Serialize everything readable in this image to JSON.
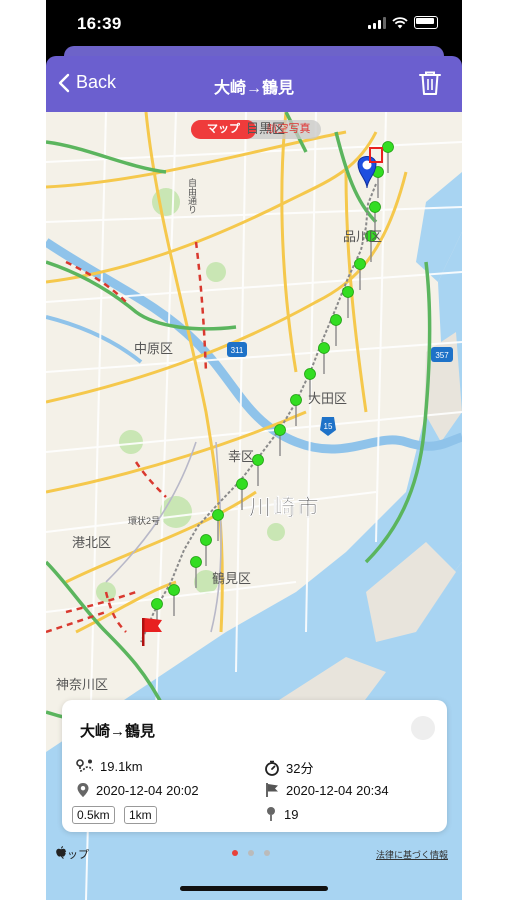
{
  "status_bar": {
    "time": "16:39"
  },
  "nav": {
    "back_label": "Back",
    "title": "大崎→鶴見"
  },
  "map": {
    "segment": {
      "options": [
        "マップ",
        "航空写真"
      ],
      "selected": 0
    },
    "labels": {
      "meguro": "目黒区",
      "shinagawa": "品川区",
      "nakahara": "中原区",
      "ota": "大田区",
      "saiwai": "幸区",
      "kawasaki": "川崎市",
      "kohoku": "港北区",
      "tsurumi": "鶴見区",
      "kanagawa": "神奈川区",
      "jiyudori": "自由通り",
      "kanjo2": "環状2号"
    },
    "route_shields": [
      "311",
      "357",
      "15"
    ],
    "attribution": "マップ",
    "legal_link": "法律に基づく情報"
  },
  "card": {
    "title": "大崎→鶴見",
    "distance": "19.1km",
    "duration": "32分",
    "start_time": "2020-12-04 20:02",
    "end_time": "2020-12-04 20:34",
    "points": "19",
    "tags": [
      "0.5km",
      "1km"
    ]
  },
  "pager": {
    "count": 3,
    "active": 0
  },
  "colors": {
    "nav_bg": "#6b5fcf",
    "pin_green": "#33dd22",
    "start_pin": "#1e4fe0",
    "flag": "#e82020",
    "active_dot": "#e8413a"
  },
  "icons": [
    "back-chevron-icon",
    "trash-icon",
    "distance-icon",
    "stopwatch-icon",
    "location-pin-icon",
    "flag-icon",
    "pin-icon",
    "apple-logo-icon"
  ]
}
